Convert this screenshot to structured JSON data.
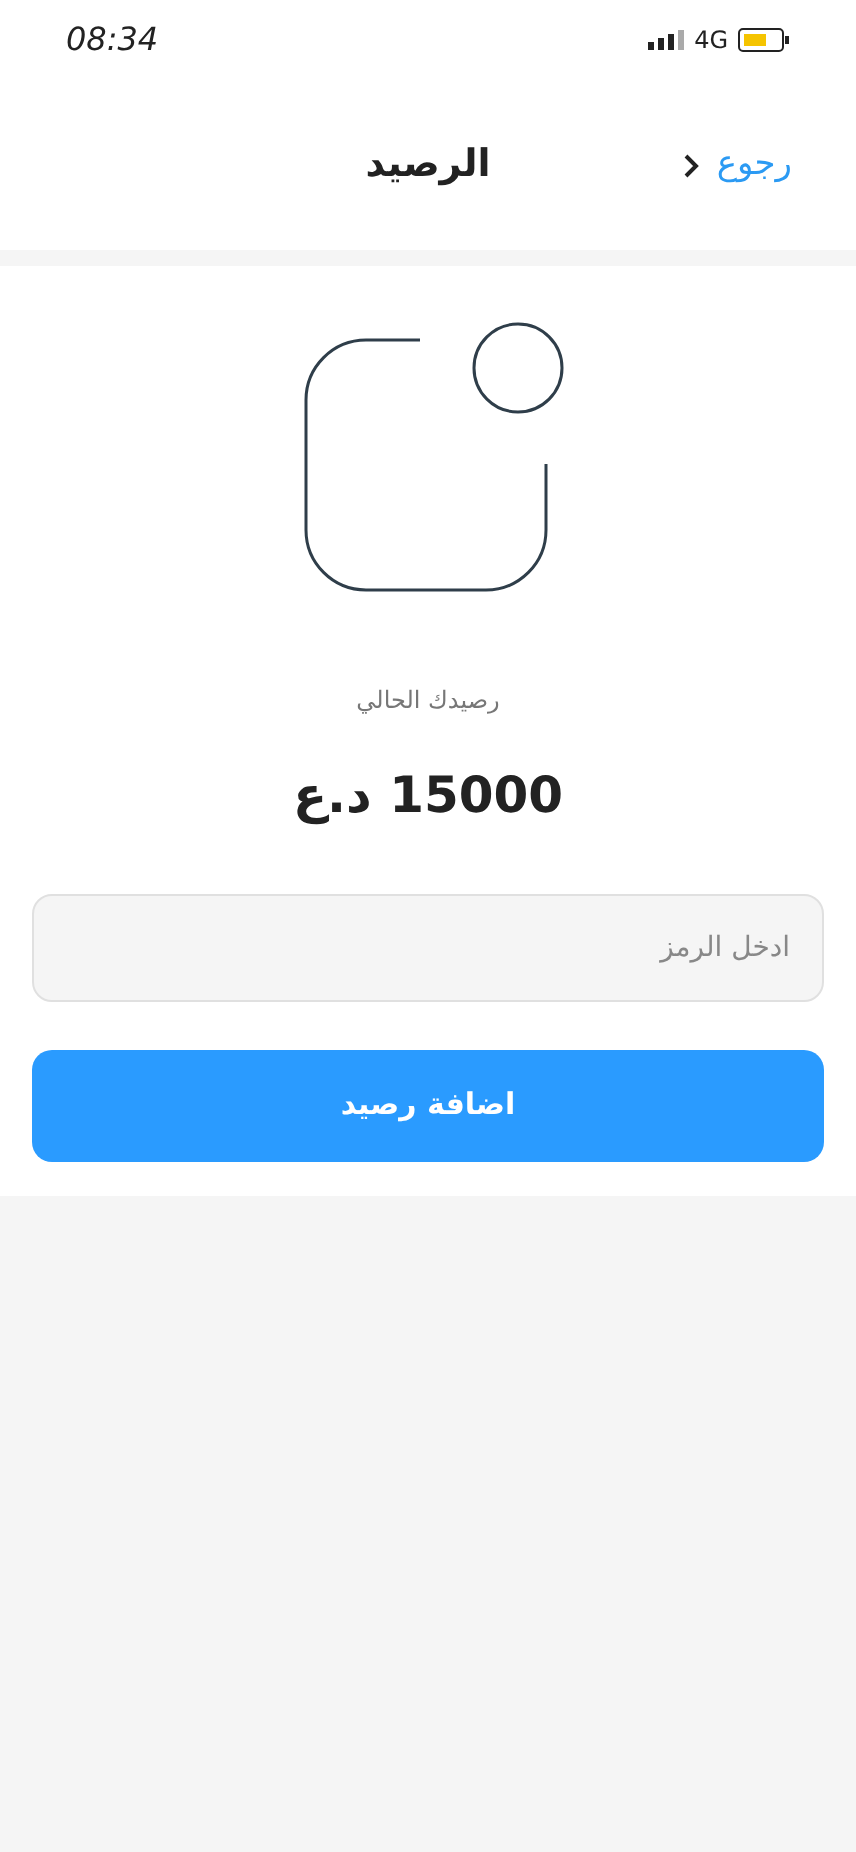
{
  "status_bar": {
    "time": "08:34",
    "network": "4G"
  },
  "header": {
    "title": "الرصيد",
    "back": "رجوع"
  },
  "balance": {
    "label": "رصيدك الحالي",
    "amount": "15000 د.ع"
  },
  "code_field": {
    "placeholder": "ادخل الرمز"
  },
  "submit_button": "اضافة رصيد"
}
